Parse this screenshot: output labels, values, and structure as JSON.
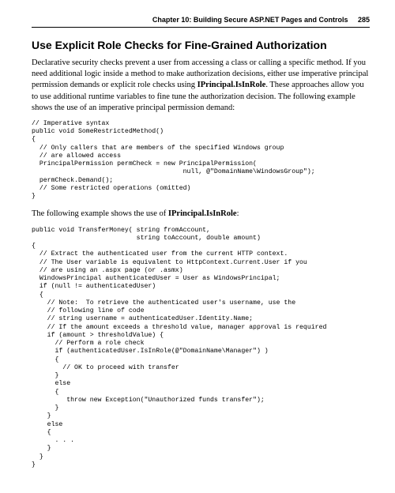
{
  "header": {
    "chapter": "Chapter 10: Building Secure ASP.NET Pages and Controls",
    "page_number": "285"
  },
  "section": {
    "title": "Use Explicit Role Checks for Fine-Grained Authorization",
    "para1_a": "Declarative security checks prevent a user from accessing a class or calling a specific method. If you need additional logic inside a method to make authorization decisions, either use imperative principal permission demands or explicit role checks using ",
    "para1_bold": "IPrincipal.IsInRole",
    "para1_b": ". These approaches allow you to use additional runtime variables to fine tune the authorization decision. The following example shows the use of an imperative principal permission demand:",
    "code1": "// Imperative syntax\npublic void SomeRestrictedMethod()\n{\n  // Only callers that are members of the specified Windows group\n  // are allowed access\n  PrincipalPermission permCheck = new PrincipalPermission(\n                                       null, @\"DomainName\\WindowsGroup\");\n  permCheck.Demand();\n  // Some restricted operations (omitted)\n}",
    "para2_a": "The following example shows the use of ",
    "para2_bold": "IPrincipal.IsInRole",
    "para2_b": ":",
    "code2": "public void TransferMoney( string fromAccount,\n                           string toAccount, double amount)\n{\n  // Extract the authenticated user from the current HTTP context.\n  // The User variable is equivalent to HttpContext.Current.User if you\n  // are using an .aspx page (or .asmx)\n  WindowsPrincipal authenticatedUser = User as WindowsPrincipal;\n  if (null != authenticatedUser)\n  {\n    // Note:  To retrieve the authenticated user's username, use the\n    // following line of code\n    // string username = authenticatedUser.Identity.Name;\n    // If the amount exceeds a threshold value, manager approval is required\n    if (amount > thresholdValue) {\n      // Perform a role check\n      if (authenticatedUser.IsInRole(@\"DomainName\\Manager\") )\n      {\n        // OK to proceed with transfer\n      }\n      else\n      {\n         throw new Exception(\"Unauthorized funds transfer\");\n      }\n    }\n    else\n    {\n      . . .\n    }\n  }\n}"
  }
}
